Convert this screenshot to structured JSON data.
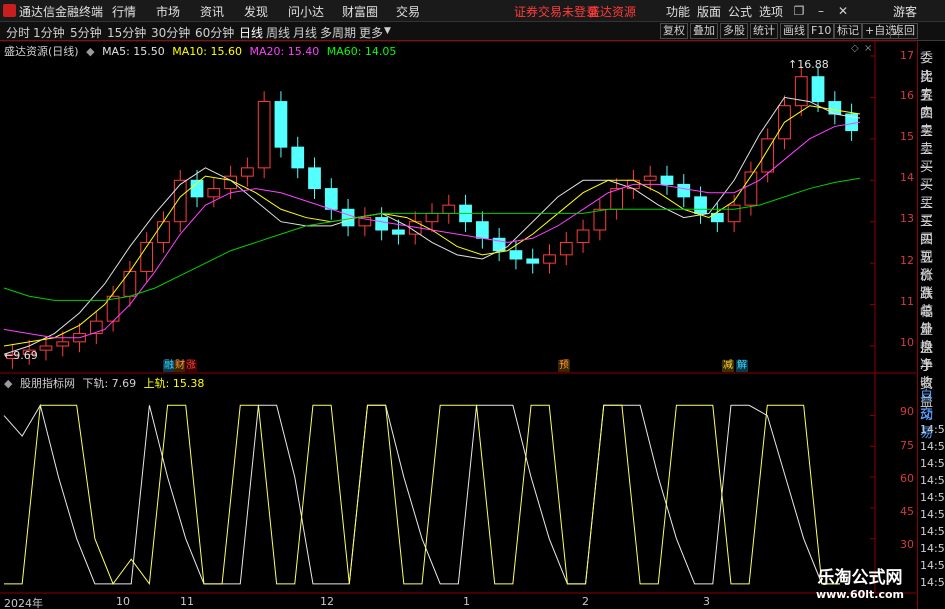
{
  "app": {
    "title": "通达信金融终端",
    "menu": [
      "行情",
      "市场",
      "资讯",
      "发现",
      "问小达",
      "财富圈",
      "交易"
    ],
    "alert1": "证券交易未登录",
    "alert2": "盛达资源",
    "right_menu": [
      "功能",
      "版面",
      "公式",
      "选项"
    ],
    "user": "游客"
  },
  "toolbar": {
    "periods": [
      "分时",
      "1分钟",
      "5分钟",
      "15分钟",
      "30分钟",
      "60分钟",
      "日线",
      "周线",
      "月线",
      "多周期",
      "更多"
    ],
    "active_period": "日线",
    "buttons": [
      "复权",
      "叠加",
      "多股",
      "统计",
      "画线",
      "F10",
      "标记",
      "+自选",
      "返回"
    ]
  },
  "main_legend": {
    "stock": "盛达资源(日线)",
    "ma5": "MA5: 15.50",
    "ma10": "MA10: 15.60",
    "ma20": "MA20: 15.40",
    "ma60": "MA60: 14.05",
    "colors": {
      "ma5": "#ffffff",
      "ma10": "#ffff00",
      "ma20": "#ff40ff",
      "ma60": "#00ff00"
    }
  },
  "sub_legend": {
    "name": "股朋指标网",
    "lower": "下轨: 7.69",
    "upper": "上轨: 15.38"
  },
  "right_panel": {
    "items_top": [
      "委比",
      "卖五",
      "卖四",
      "卖三",
      "卖二",
      "卖一",
      "买一",
      "买二",
      "买三",
      "买四",
      "买五",
      "现价",
      "涨跌",
      "涨幅",
      "总量",
      "外盘",
      "换手",
      "净资",
      "收益"
    ],
    "items_bottom": [
      "自动",
      "交易"
    ],
    "times": [
      "14:56",
      "14:56",
      "14:56",
      "14:56",
      "14:56",
      "14:56",
      "14:56",
      "14:56",
      "14:56",
      "14:56"
    ]
  },
  "event_badges": [
    {
      "label": "融",
      "color": "#3cd2ff"
    },
    {
      "label": "财",
      "color": "#ff9a3c"
    },
    {
      "label": "涨",
      "color": "#ff4040"
    },
    {
      "label": "预",
      "color": "#ff9a3c"
    },
    {
      "label": "减",
      "color": "#ffd23c"
    },
    {
      "label": "解",
      "color": "#3cd2ff"
    }
  ],
  "watermark": {
    "line1": "乐淘公式网",
    "line2": "www.60lt.com"
  },
  "chart_data": [
    {
      "type": "candlestick",
      "title": "盛达资源(日线)",
      "ylim": [
        9.5,
        17.3
      ],
      "yticks": [
        10.0,
        11.0,
        12.0,
        13.0,
        14.0,
        15.0,
        16.0,
        17.0
      ],
      "x_labels": [
        "2024年",
        "10",
        "11",
        "12",
        "1",
        "2",
        "3"
      ],
      "annotations": {
        "high": "16.88",
        "low": "9.69"
      },
      "candles_approx_close": [
        9.8,
        9.9,
        10.0,
        10.1,
        10.3,
        10.6,
        11.2,
        11.8,
        12.5,
        13.0,
        14.0,
        13.6,
        13.8,
        14.1,
        14.3,
        15.9,
        14.8,
        14.3,
        13.8,
        13.3,
        12.9,
        13.1,
        12.8,
        12.7,
        13.0,
        13.2,
        13.4,
        13.0,
        12.6,
        12.3,
        12.1,
        12.0,
        12.2,
        12.5,
        12.8,
        13.3,
        13.8,
        14.0,
        14.1,
        13.9,
        13.6,
        13.2,
        13.0,
        13.4,
        14.2,
        15.0,
        15.8,
        16.5,
        15.9,
        15.6,
        15.2
      ],
      "series": [
        {
          "name": "MA5",
          "values": [
            9.8,
            10.0,
            10.3,
            10.8,
            11.5,
            12.4,
            13.2,
            13.9,
            14.3,
            14.0,
            13.5,
            13.0,
            12.9,
            12.9,
            13.1,
            13.2,
            12.9,
            12.5,
            12.2,
            12.1,
            12.4,
            13.0,
            13.6,
            14.0,
            14.0,
            13.8,
            13.4,
            13.1,
            13.2,
            14.0,
            15.1,
            16.0,
            15.9,
            15.6,
            15.5
          ]
        },
        {
          "name": "MA10",
          "values": [
            10.0,
            10.1,
            10.2,
            10.5,
            11.0,
            11.8,
            12.7,
            13.6,
            14.1,
            14.0,
            13.7,
            13.3,
            13.1,
            13.0,
            13.1,
            13.2,
            13.1,
            12.8,
            12.4,
            12.2,
            12.3,
            12.7,
            13.2,
            13.7,
            14.0,
            14.0,
            13.7,
            13.3,
            13.1,
            13.5,
            14.4,
            15.4,
            15.8,
            15.7,
            15.6
          ]
        },
        {
          "name": "MA20",
          "values": [
            10.4,
            10.3,
            10.2,
            10.2,
            10.4,
            11.0,
            11.8,
            12.7,
            13.4,
            13.7,
            13.8,
            13.7,
            13.5,
            13.3,
            13.1,
            13.0,
            12.9,
            12.8,
            12.7,
            12.6,
            12.5,
            12.6,
            12.9,
            13.3,
            13.7,
            13.9,
            13.9,
            13.8,
            13.7,
            13.7,
            14.0,
            14.5,
            15.0,
            15.3,
            15.4
          ]
        },
        {
          "name": "MA60",
          "values": [
            11.4,
            11.2,
            11.1,
            11.1,
            11.1,
            11.2,
            11.4,
            11.7,
            12.0,
            12.3,
            12.5,
            12.7,
            12.9,
            13.0,
            13.1,
            13.2,
            13.2,
            13.2,
            13.2,
            13.2,
            13.2,
            13.2,
            13.2,
            13.2,
            13.3,
            13.3,
            13.3,
            13.3,
            13.3,
            13.3,
            13.4,
            13.6,
            13.8,
            13.95,
            14.05
          ]
        }
      ]
    },
    {
      "type": "line",
      "title": "股朋指标网",
      "ylim": [
        5,
        100
      ],
      "yticks": [
        30.0,
        45.0,
        60.0,
        75.0,
        90.0
      ],
      "series": [
        {
          "name": "下轨",
          "values": [
            90,
            80,
            95,
            60,
            30,
            8,
            8,
            8,
            95,
            60,
            30,
            8,
            8,
            8,
            95,
            95,
            60,
            8,
            8,
            8,
            95,
            95,
            60,
            30,
            8,
            8,
            95,
            95,
            95,
            60,
            30,
            8,
            8,
            95,
            95,
            95,
            60,
            30,
            8,
            8,
            95,
            95,
            90,
            60,
            30,
            8,
            8
          ]
        },
        {
          "name": "上轨",
          "values": [
            8,
            8,
            95,
            95,
            95,
            30,
            8,
            20,
            8,
            95,
            95,
            8,
            8,
            95,
            95,
            8,
            8,
            95,
            95,
            8,
            95,
            95,
            8,
            8,
            95,
            95,
            95,
            8,
            8,
            95,
            95,
            8,
            8,
            95,
            95,
            8,
            8,
            95,
            95,
            95,
            8,
            8,
            95,
            95,
            95,
            8,
            8
          ]
        }
      ]
    }
  ]
}
